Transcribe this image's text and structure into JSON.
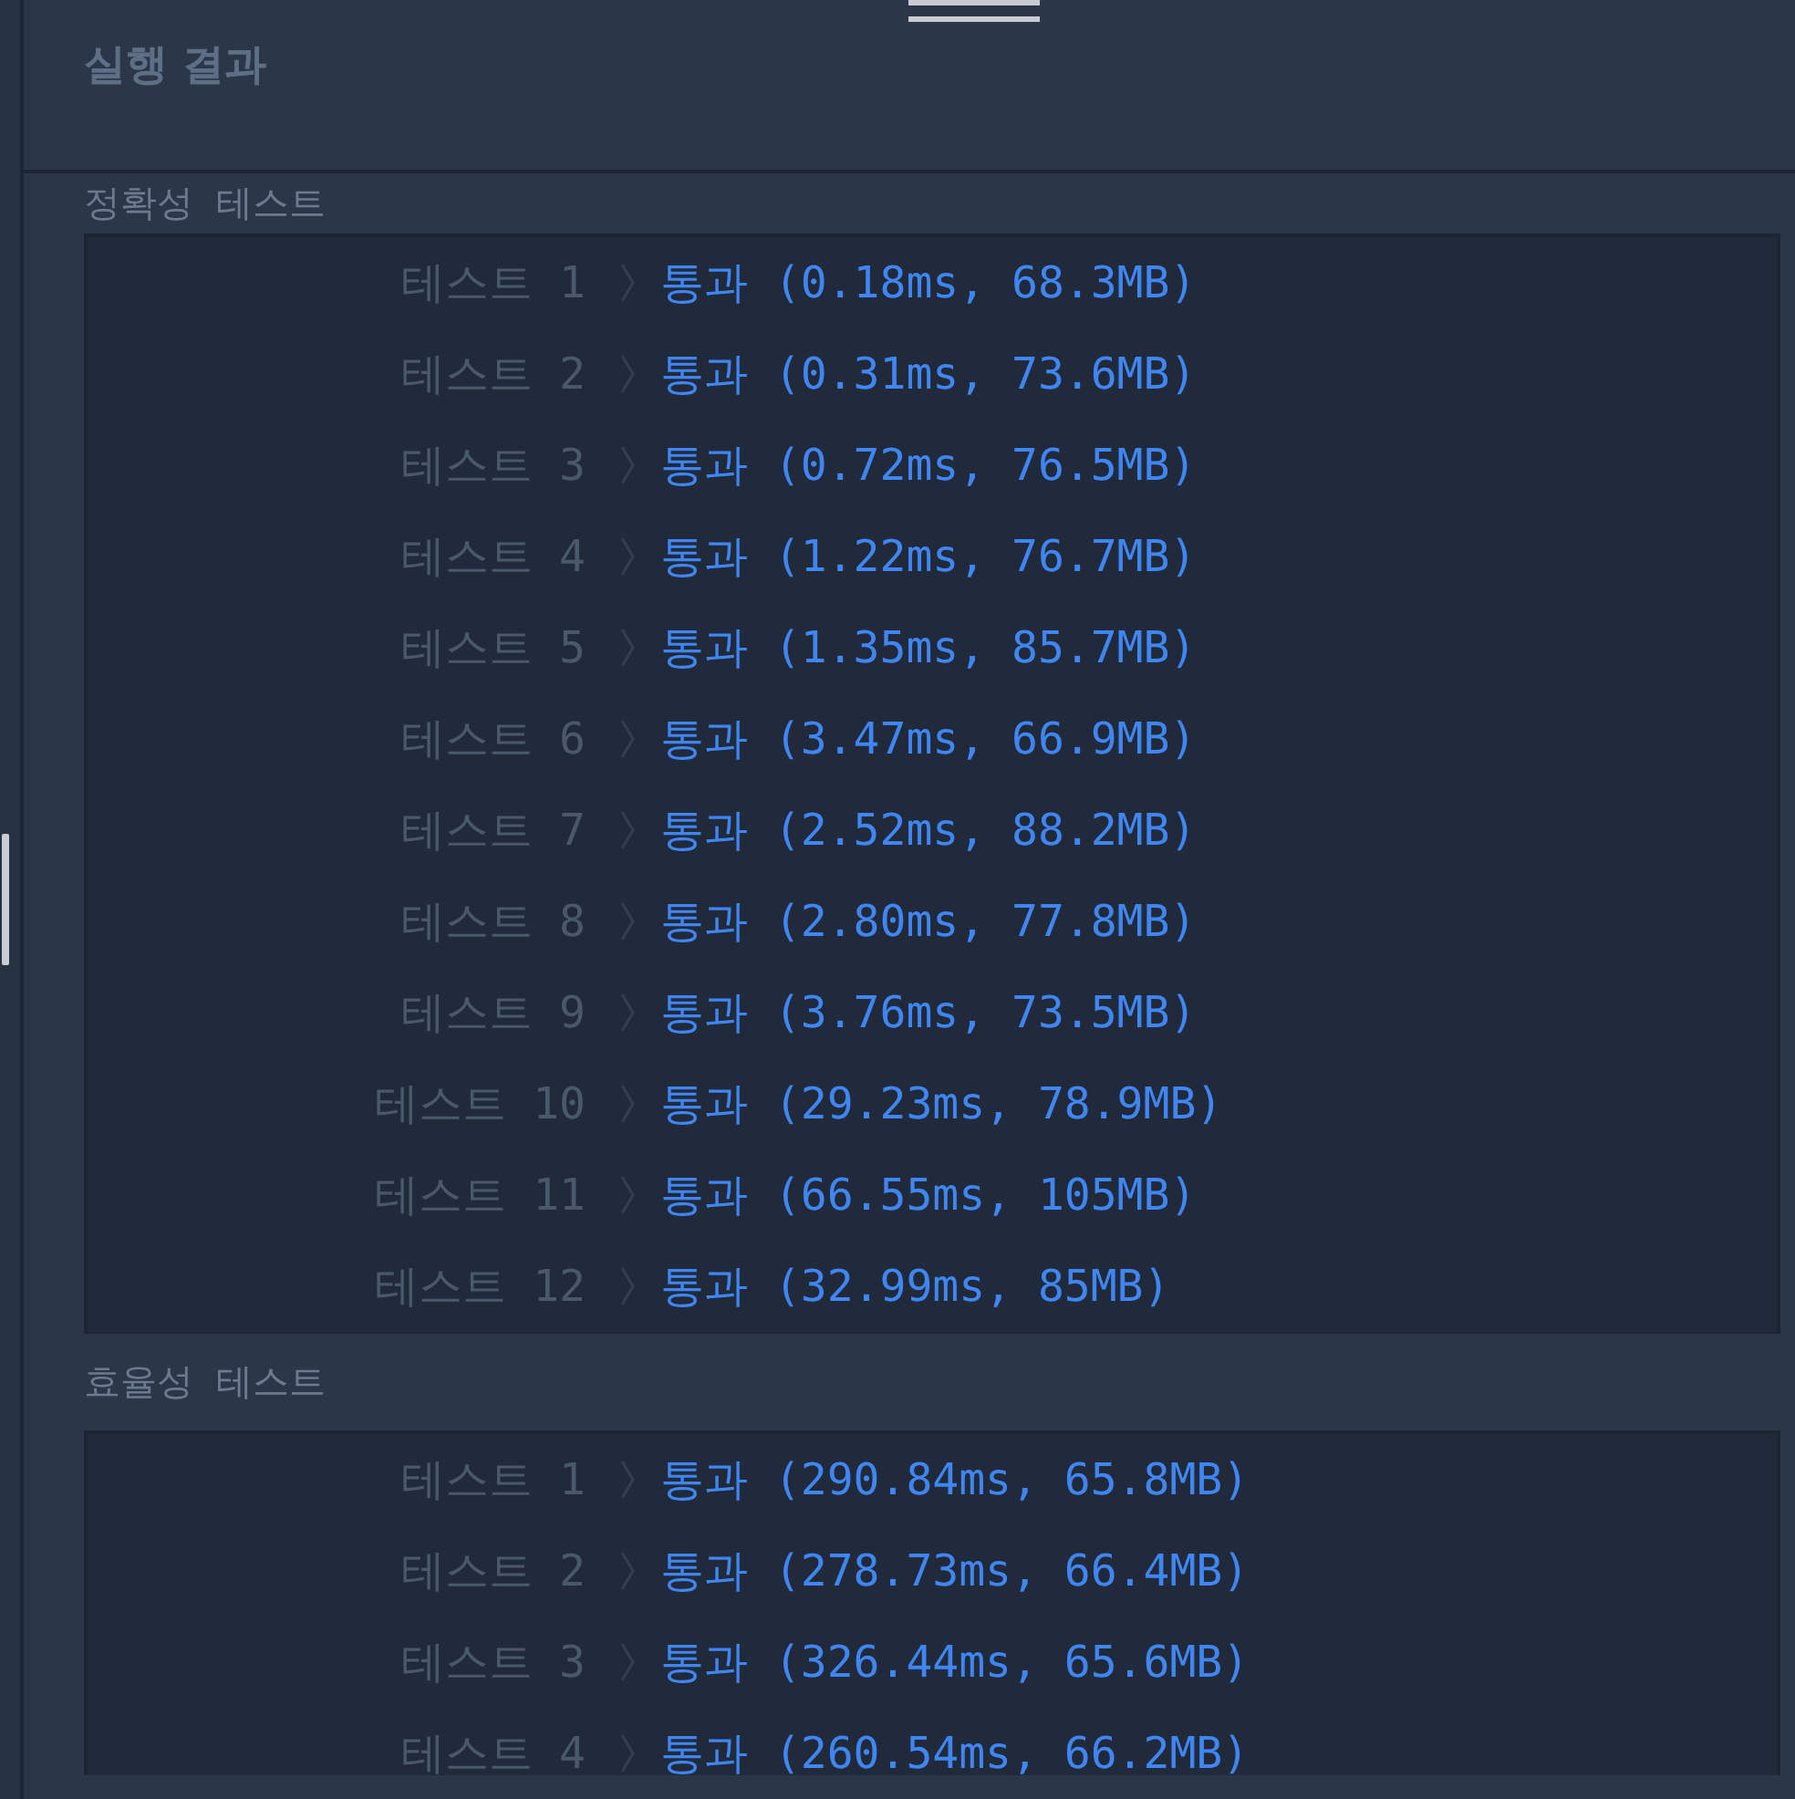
{
  "panel": {
    "title": "실행 결과"
  },
  "sections": [
    {
      "title": "정확성  테스트",
      "rows": [
        {
          "label": "테스트 1",
          "result": "통과 (0.18ms, 68.3MB)"
        },
        {
          "label": "테스트 2",
          "result": "통과 (0.31ms, 73.6MB)"
        },
        {
          "label": "테스트 3",
          "result": "통과 (0.72ms, 76.5MB)"
        },
        {
          "label": "테스트 4",
          "result": "통과 (1.22ms, 76.7MB)"
        },
        {
          "label": "테스트 5",
          "result": "통과 (1.35ms, 85.7MB)"
        },
        {
          "label": "테스트 6",
          "result": "통과 (3.47ms, 66.9MB)"
        },
        {
          "label": "테스트 7",
          "result": "통과 (2.52ms, 88.2MB)"
        },
        {
          "label": "테스트 8",
          "result": "통과 (2.80ms, 77.8MB)"
        },
        {
          "label": "테스트 9",
          "result": "통과 (3.76ms, 73.5MB)"
        },
        {
          "label": "테스트 10",
          "result": "통과 (29.23ms, 78.9MB)"
        },
        {
          "label": "테스트 11",
          "result": "통과 (66.55ms, 105MB)"
        },
        {
          "label": "테스트 12",
          "result": "통과 (32.99ms, 85MB)"
        }
      ]
    },
    {
      "title": "효율성  테스트",
      "rows": [
        {
          "label": "테스트 1",
          "result": "통과 (290.84ms, 65.8MB)"
        },
        {
          "label": "테스트 2",
          "result": "통과 (278.73ms, 66.4MB)"
        },
        {
          "label": "테스트 3",
          "result": "통과 (326.44ms, 65.6MB)"
        },
        {
          "label": "테스트 4",
          "result": "통과 (260.54ms, 66.2MB)"
        }
      ]
    }
  ]
}
